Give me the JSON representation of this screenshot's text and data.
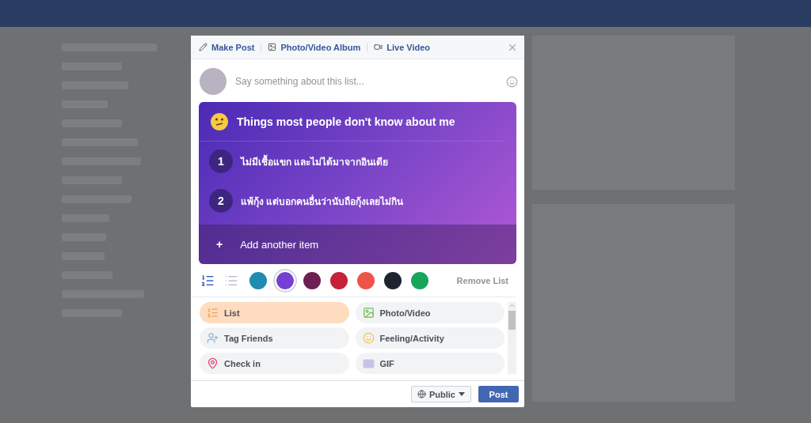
{
  "tabs": [
    {
      "label": "Make Post"
    },
    {
      "label": "Photo/Video Album"
    },
    {
      "label": "Live Video"
    }
  ],
  "composer": {
    "placeholder": "Say something about this list..."
  },
  "list_card": {
    "title": "Things most people don't know about me",
    "items": [
      {
        "number": "1",
        "text": "ไม่มีเชื้อแขก และไม่ได้มาจากอินเดีย"
      },
      {
        "number": "2",
        "text": "แพ้กุ้ง แต่บอกคนอื่นว่านับถือกุ้งเลยไม่กิน"
      }
    ],
    "add_symbol": "+",
    "add_label": "Add another item"
  },
  "list_styles": [
    {
      "kind": "numbered",
      "selected": true
    },
    {
      "kind": "bulleted",
      "selected": false
    }
  ],
  "swatches": [
    {
      "color": "#1f8cb0",
      "selected": false
    },
    {
      "color": "#7440d4",
      "selected": true
    },
    {
      "color": "#6e1f52",
      "selected": false
    },
    {
      "color": "#c6203a",
      "selected": false
    },
    {
      "color": "#ee5548",
      "selected": false
    },
    {
      "color": "#1e2330",
      "selected": false
    },
    {
      "color": "#16a65a",
      "selected": false
    }
  ],
  "remove_label": "Remove List",
  "options": [
    {
      "label": "List",
      "selected": true
    },
    {
      "label": "Photo/Video",
      "selected": false
    },
    {
      "label": "Tag Friends",
      "selected": false
    },
    {
      "label": "Feeling/Activity",
      "selected": false
    },
    {
      "label": "Check in",
      "selected": false
    },
    {
      "label": "GIF",
      "selected": false
    }
  ],
  "footer": {
    "audience": "Public",
    "post": "Post"
  }
}
